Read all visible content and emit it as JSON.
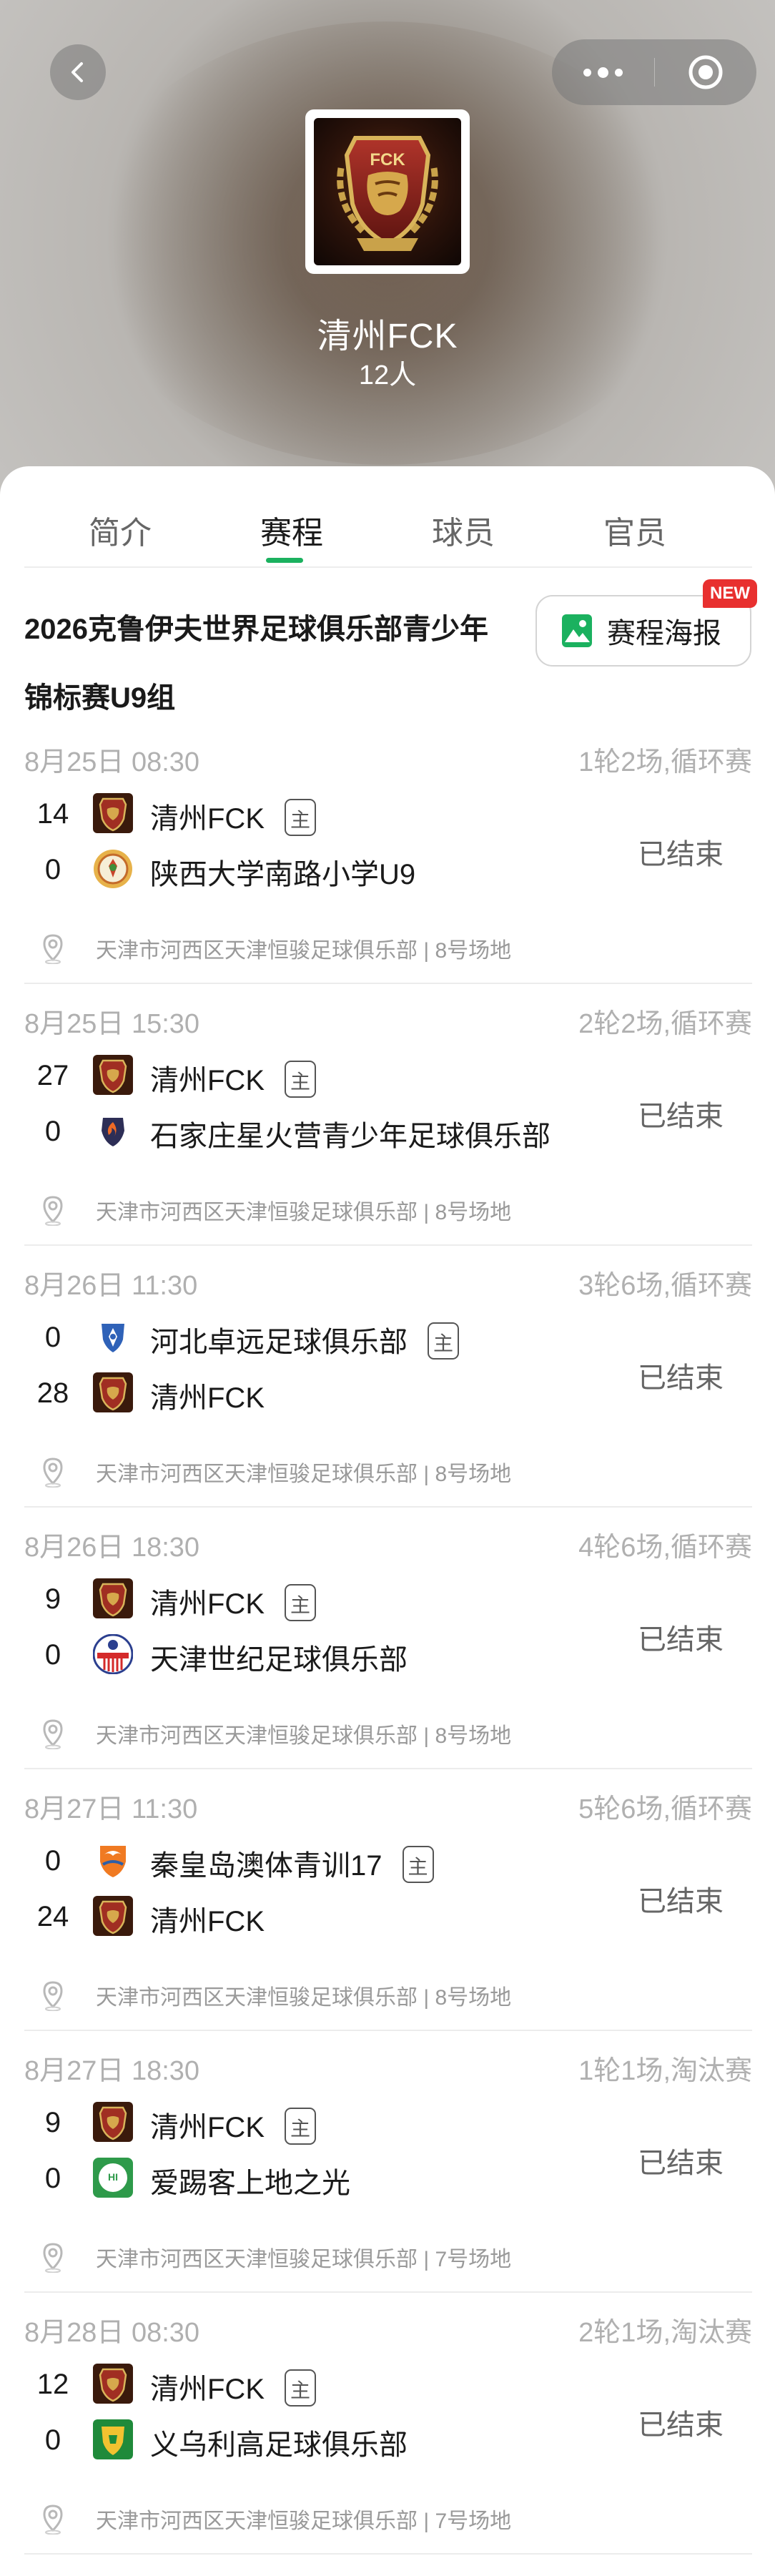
{
  "header": {
    "team_name": "清州FCK",
    "member_count": "12人",
    "logo_text": "FCK"
  },
  "tabs": [
    {
      "label": "简介",
      "active": false
    },
    {
      "label": "赛程",
      "active": true
    },
    {
      "label": "球员",
      "active": false
    },
    {
      "label": "官员",
      "active": false
    }
  ],
  "competition": {
    "title_line1": "2026克鲁伊夫世界足球俱乐部青少年",
    "title_line2": "锦标赛U9组",
    "poster_button": "赛程海报",
    "new_badge": "NEW"
  },
  "home_badge_label": "主",
  "colors": {
    "accent": "#1bb15f",
    "new_badge": "#e8302f",
    "muted_text": "#b0b0b0"
  },
  "matches": [
    {
      "date": "8月25日 08:30",
      "round": "1轮2场,循环赛",
      "status": "已结束",
      "venue": "天津市河西区天津恒骏足球俱乐部 | 8号场地",
      "teams": [
        {
          "score": "14",
          "name": "清州FCK",
          "home": true,
          "logo": "fck"
        },
        {
          "score": "0",
          "name": "陕西大学南路小学U9",
          "home": false,
          "logo": "shaanxi"
        }
      ]
    },
    {
      "date": "8月25日 15:30",
      "round": "2轮2场,循环赛",
      "status": "已结束",
      "venue": "天津市河西区天津恒骏足球俱乐部 | 8号场地",
      "teams": [
        {
          "score": "27",
          "name": "清州FCK",
          "home": true,
          "logo": "fck"
        },
        {
          "score": "0",
          "name": "石家庄星火营青少年足球俱乐部",
          "home": false,
          "logo": "xinghuo"
        }
      ]
    },
    {
      "date": "8月26日 11:30",
      "round": "3轮6场,循环赛",
      "status": "已结束",
      "venue": "天津市河西区天津恒骏足球俱乐部 | 8号场地",
      "teams": [
        {
          "score": "0",
          "name": "河北卓远足球俱乐部",
          "home": true,
          "logo": "zhuoyuan"
        },
        {
          "score": "28",
          "name": "清州FCK",
          "home": false,
          "logo": "fck"
        }
      ]
    },
    {
      "date": "8月26日 18:30",
      "round": "4轮6场,循环赛",
      "status": "已结束",
      "venue": "天津市河西区天津恒骏足球俱乐部 | 8号场地",
      "teams": [
        {
          "score": "9",
          "name": "清州FCK",
          "home": true,
          "logo": "fck"
        },
        {
          "score": "0",
          "name": "天津世纪足球俱乐部",
          "home": false,
          "logo": "shiji"
        }
      ]
    },
    {
      "date": "8月27日 11:30",
      "round": "5轮6场,循环赛",
      "status": "已结束",
      "venue": "天津市河西区天津恒骏足球俱乐部 | 8号场地",
      "teams": [
        {
          "score": "0",
          "name": "秦皇岛澳体青训17",
          "home": true,
          "logo": "qinhuangdao"
        },
        {
          "score": "24",
          "name": "清州FCK",
          "home": false,
          "logo": "fck"
        }
      ]
    },
    {
      "date": "8月27日 18:30",
      "round": "1轮1场,淘汰赛",
      "status": "已结束",
      "venue": "天津市河西区天津恒骏足球俱乐部 | 7号场地",
      "teams": [
        {
          "score": "9",
          "name": "清州FCK",
          "home": true,
          "logo": "fck"
        },
        {
          "score": "0",
          "name": "爱踢客上地之光",
          "home": false,
          "logo": "aitike"
        }
      ]
    },
    {
      "date": "8月28日 08:30",
      "round": "2轮1场,淘汰赛",
      "status": "已结束",
      "venue": "天津市河西区天津恒骏足球俱乐部 | 7号场地",
      "teams": [
        {
          "score": "12",
          "name": "清州FCK",
          "home": true,
          "logo": "fck"
        },
        {
          "score": "0",
          "name": "义乌利高足球俱乐部",
          "home": false,
          "logo": "ligao"
        }
      ]
    }
  ]
}
